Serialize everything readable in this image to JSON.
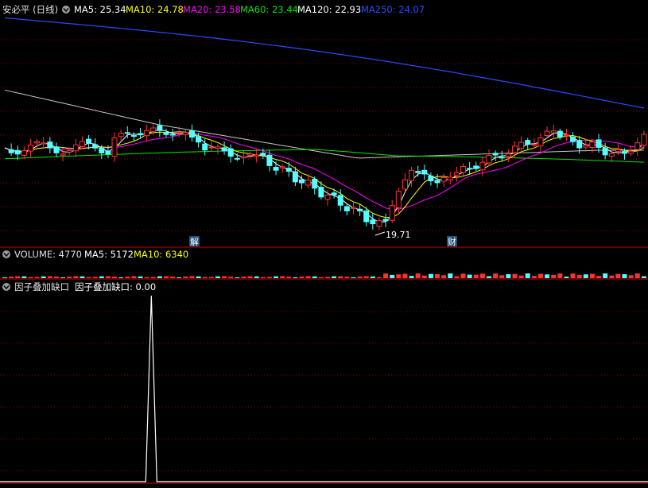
{
  "main_panel": {
    "title": "安必平 (日线)",
    "indicators": [
      {
        "label": "MA5: 25.34",
        "color": "#ffffff"
      },
      {
        "label": "MA10: 24.78",
        "color": "#ffff00"
      },
      {
        "label": "MA20: 23.58",
        "color": "#ff00ff"
      },
      {
        "label": "MA60: 23.44",
        "color": "#00e600"
      },
      {
        "label": "MA120: 22.93",
        "color": "#ffffff"
      },
      {
        "label": "MA250: 24.07",
        "color": "#2b4bff"
      }
    ],
    "low_label": "19.71",
    "event_markers": [
      {
        "label": "解"
      },
      {
        "label": "财"
      }
    ]
  },
  "volume_panel": {
    "title": "VOLUME: 4770",
    "indicators": [
      {
        "label": "MA5: 5172",
        "color": "#ffffff"
      },
      {
        "label": "MA10: 6340",
        "color": "#ffff00"
      }
    ]
  },
  "factor_panel": {
    "title": "因子叠加缺口",
    "indicator": {
      "label": "因子叠加缺口: 0.00",
      "color": "#ffffff"
    }
  },
  "colors": {
    "up": "#ff3232",
    "down": "#54ffff",
    "grid": "#8b0000",
    "separator": "#d00000",
    "ma5": "#ffffff",
    "ma10": "#ffff00",
    "ma20": "#ff00ff",
    "ma60": "#00e600",
    "ma120": "#c8c8c8",
    "ma250": "#2b4bff"
  },
  "chart_data": {
    "type": "candlestick",
    "series": [
      {
        "name": "MA5",
        "last": 25.34
      },
      {
        "name": "MA10",
        "last": 24.78
      },
      {
        "name": "MA20",
        "last": 23.58
      },
      {
        "name": "MA60",
        "last": 23.44
      },
      {
        "name": "MA120",
        "last": 22.93
      },
      {
        "name": "MA250",
        "last": 24.07
      }
    ],
    "annotations": [
      {
        "label": "19.71",
        "type": "period-low"
      }
    ],
    "volume": {
      "value": 4770,
      "ma5": 5172,
      "ma10": 6340
    },
    "factor": {
      "value": 0.0,
      "spike_at_bar": 36
    }
  }
}
